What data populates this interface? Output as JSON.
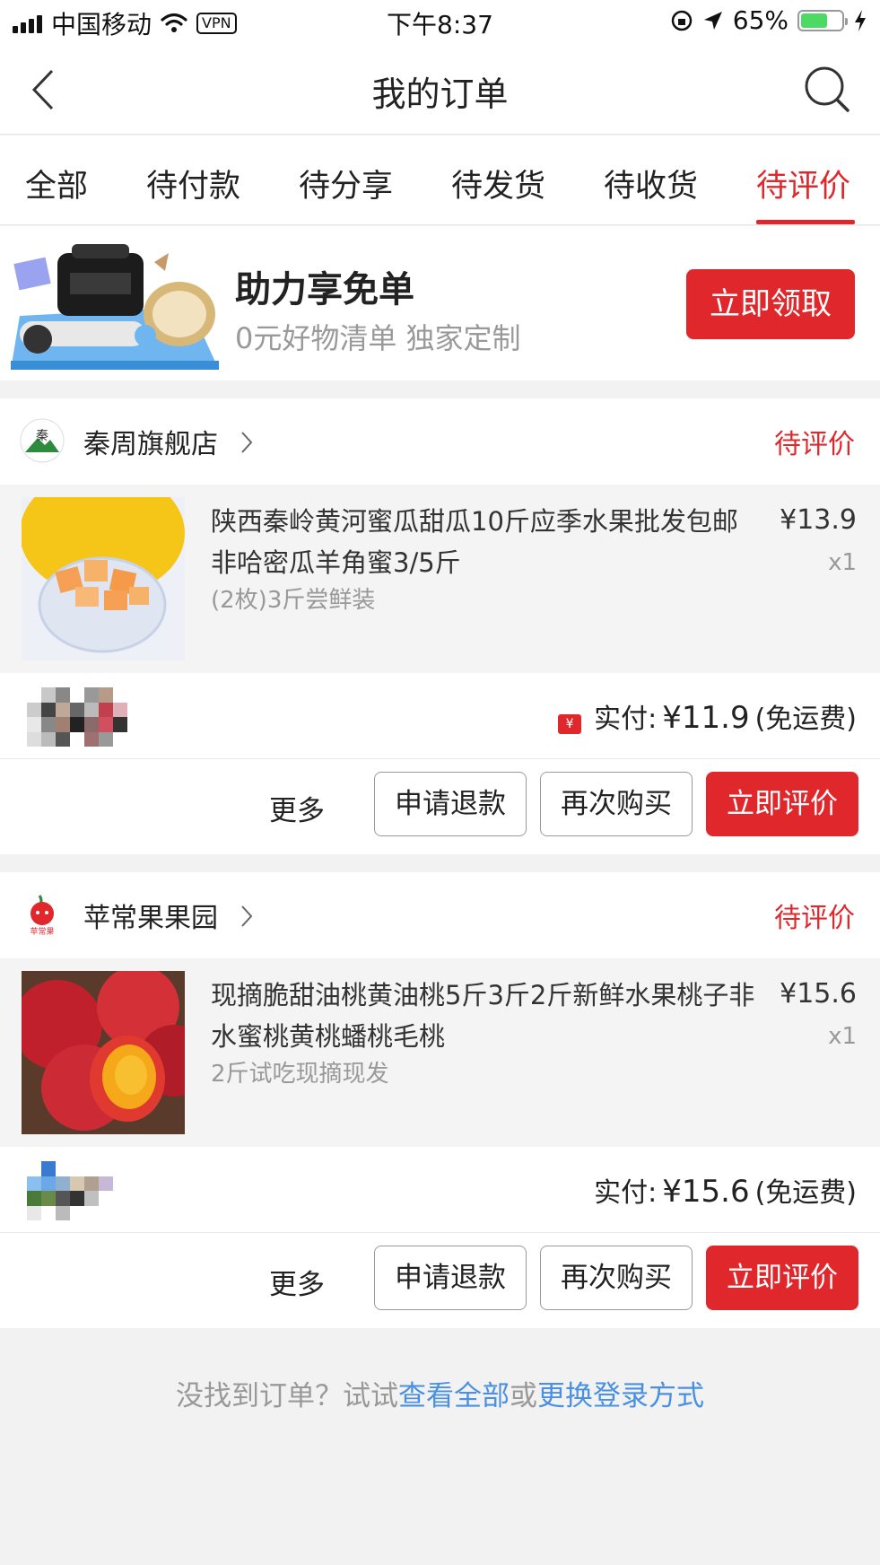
{
  "status_bar": {
    "carrier": "中国移动",
    "vpn": "VPN",
    "time": "下午8:37",
    "battery_percent": "65%",
    "battery_level": 0.65
  },
  "navbar": {
    "title": "我的订单",
    "back_icon": "chevron-left-icon",
    "search_icon": "search-icon"
  },
  "tabs": [
    "全部",
    "待付款",
    "待分享",
    "待发货",
    "待收货",
    "待评价"
  ],
  "active_tab": "待评价",
  "banner": {
    "title": "助力享免单",
    "subtitle": "0元好物清单  独家定制",
    "button": "立即领取"
  },
  "orders": [
    {
      "shop_name": "秦周旗舰店",
      "status": "待评价",
      "item_title": "陕西秦岭黄河蜜瓜甜瓜10斤应季水果批发包邮非哈密瓜羊角蜜3/5斤",
      "item_spec": "(2枚)3斤尝鲜装",
      "price": "¥13.9",
      "qty": "x1",
      "paid_label": "实付:",
      "paid_amount": "¥11.9",
      "shipping": "(免运费)",
      "red_packet_icon": "¥",
      "more": "更多",
      "refund": "申请退款",
      "rebuy": "再次购买",
      "review": "立即评价"
    },
    {
      "shop_name": "苹常果果园",
      "status": "待评价",
      "item_title": "现摘脆甜油桃黄油桃5斤3斤2斤新鲜水果桃子非水蜜桃黄桃蟠桃毛桃",
      "item_spec": "2斤试吃现摘现发",
      "price": "¥15.6",
      "qty": "x1",
      "paid_label": "实付:",
      "paid_amount": "¥15.6",
      "shipping": "(免运费)",
      "more": "更多",
      "refund": "申请退款",
      "rebuy": "再次购买",
      "review": "立即评价"
    }
  ],
  "footer": {
    "prefix": "没找到订单？试试",
    "link_all": "查看全部",
    "or": "或",
    "link_login": "更换登录方式"
  },
  "colors": {
    "accent": "#e0282c",
    "link": "#4a90e2",
    "battery": "#4cd964"
  }
}
